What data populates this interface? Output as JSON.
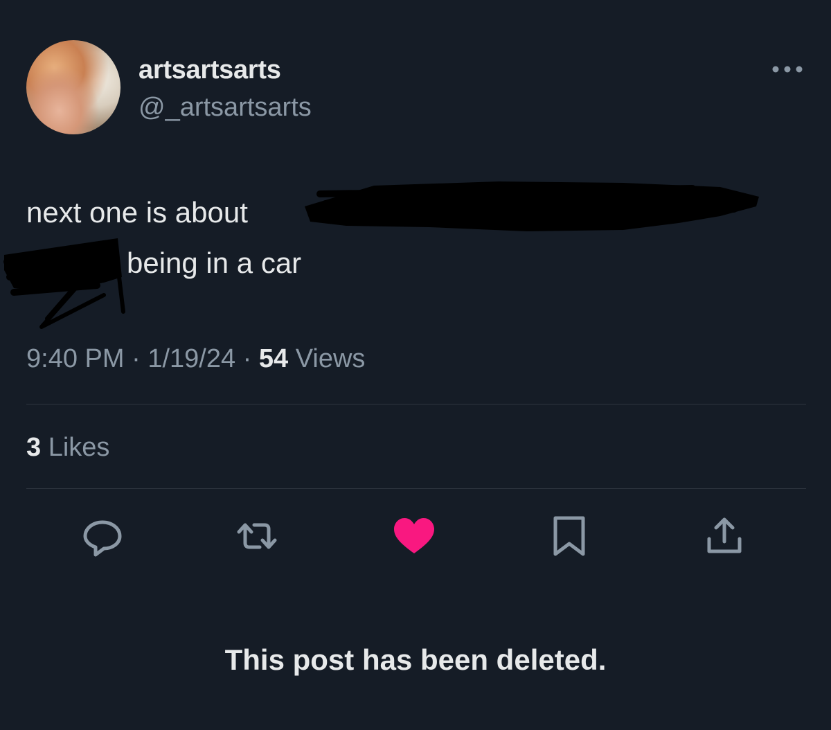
{
  "author": {
    "display_name": "artsartsarts",
    "handle": "@_artsartsarts"
  },
  "post": {
    "line1": "next one is about",
    "line2": "being in a car",
    "redacted": true
  },
  "meta": {
    "time": "9:40 PM",
    "separator": "·",
    "date": "1/19/24",
    "views_count": "54",
    "views_label": "Views"
  },
  "engagement": {
    "likes_count": "3",
    "likes_label": "Likes"
  },
  "actions": [
    {
      "name": "reply",
      "icon": "reply-icon"
    },
    {
      "name": "repost",
      "icon": "repost-icon"
    },
    {
      "name": "like",
      "icon": "heart-icon",
      "active": true
    },
    {
      "name": "bookmark",
      "icon": "bookmark-icon"
    },
    {
      "name": "share",
      "icon": "share-icon"
    }
  ],
  "notice": "This post has been deleted.",
  "colors": {
    "background": "#151c26",
    "text_primary": "#e7e9ea",
    "text_secondary": "#8b98a5",
    "like_active": "#f91880",
    "divider": "#2f3640"
  }
}
